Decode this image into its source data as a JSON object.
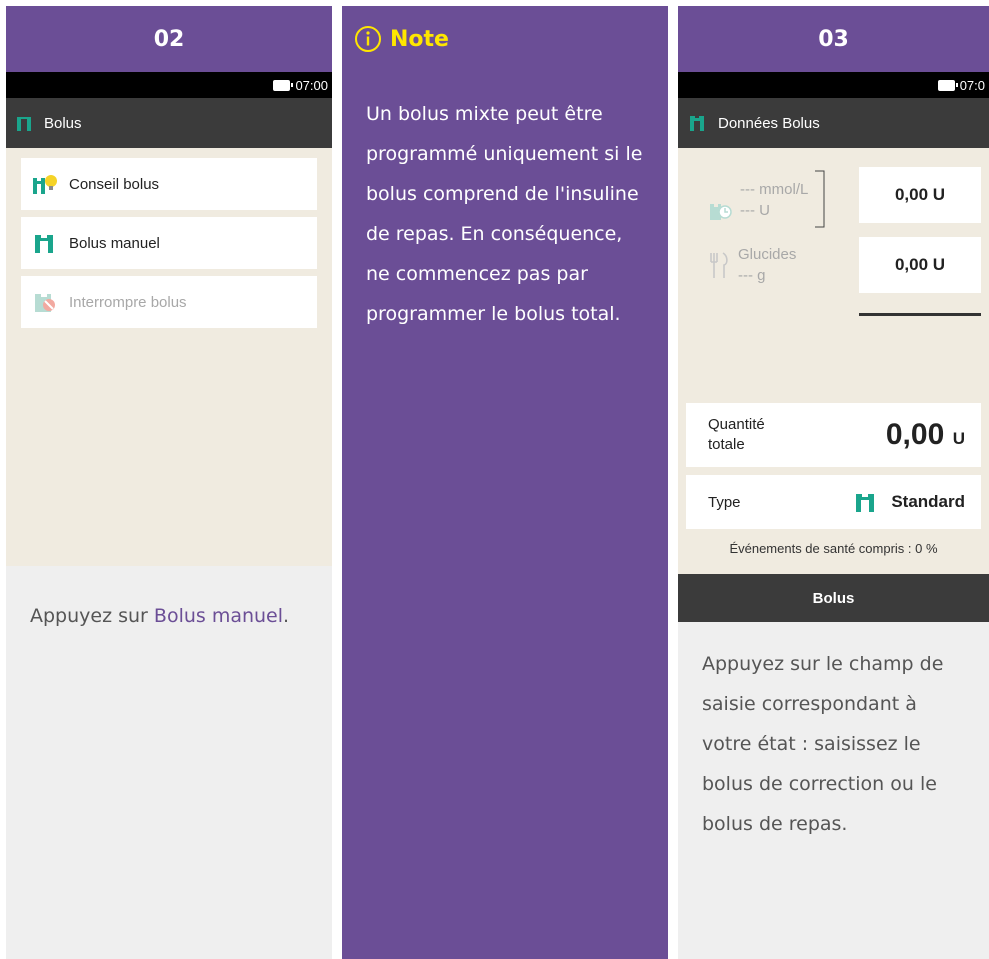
{
  "step_left": {
    "number": "02",
    "status_time": "07:00",
    "screen_title": "Bolus",
    "menu": [
      {
        "label": "Conseil bolus",
        "icon": "bolus-advice-icon"
      },
      {
        "label": "Bolus manuel",
        "icon": "bolus-icon"
      },
      {
        "label": "Interrompre bolus",
        "icon": "cancel-bolus-icon"
      }
    ],
    "caption_prefix": "Appuyez sur ",
    "caption_link": "Bolus manuel",
    "caption_suffix": "."
  },
  "note": {
    "title": "Note",
    "icon": "info-icon",
    "text": "Un bolus mixte peut être programmé uniquement si le bolus comprend de l'insuline de repas. En conséquence, ne commencez pas par programmer le bolus total."
  },
  "step_right": {
    "number": "03",
    "status_time": "07:0",
    "screen_title": "Données Bolus",
    "correction": {
      "glucose": "--- mmol/L",
      "units": "--- U",
      "value": "0,00 U"
    },
    "meal": {
      "label": "Glucides",
      "carbs": "--- g",
      "value": "0,00 U"
    },
    "total": {
      "label": "Quantité totale",
      "value": "0,00",
      "unit": "U"
    },
    "type": {
      "label": "Type",
      "value": "Standard"
    },
    "health_events": "Événements de santé compris : 0 %",
    "button": "Bolus",
    "caption": "Appuyez sur le champ de saisie correspondant à votre état : saisissez le bolus de correction ou le bolus de repas."
  },
  "colors": {
    "purple": "#6b4e96",
    "green": "#1aa58c",
    "yellow": "#ffe600",
    "beige": "#f0ebe0",
    "dark": "#3b3b3b"
  }
}
